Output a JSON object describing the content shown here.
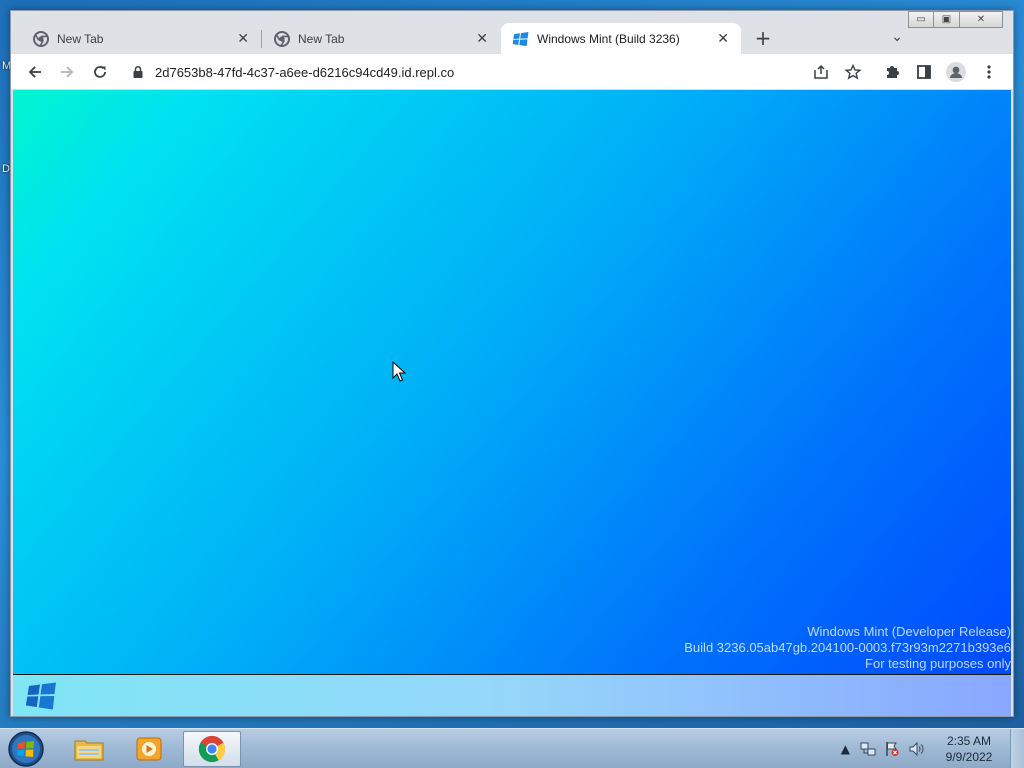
{
  "desktop": {
    "letter_top": "M",
    "letter_mid": "D"
  },
  "window_controls": {
    "minimize": "▭",
    "restore": "▣",
    "close": "✕"
  },
  "tabs": [
    {
      "title": "New Tab",
      "icon": "chrome-icon"
    },
    {
      "title": "New Tab",
      "icon": "chrome-icon"
    },
    {
      "title": "Windows Mint (Build 3236)",
      "icon": "windows-logo-icon",
      "active": true
    }
  ],
  "tab_close_glyph": "✕",
  "new_tab_glyph": "+",
  "tab_search_glyph": "⌄",
  "toolbar": {
    "url": "2d7653b8-47fd-4c37-a6ee-d6216c94cd49.id.repl.co"
  },
  "page": {
    "watermark": [
      "Windows Mint (Developer Release)",
      "Build 3236.05ab47gb.204100-0003.f73r93m2271b393e6",
      "For testing purposes only"
    ]
  },
  "taskbar": {
    "tray_up": "▲",
    "clock_time": "2:35 AM",
    "clock_date": "9/9/2022"
  },
  "colors": {
    "page_gradient_start": "#00f5d0",
    "page_gradient_end": "#0046ff",
    "chrome_tabstrip": "#dee1e6"
  }
}
